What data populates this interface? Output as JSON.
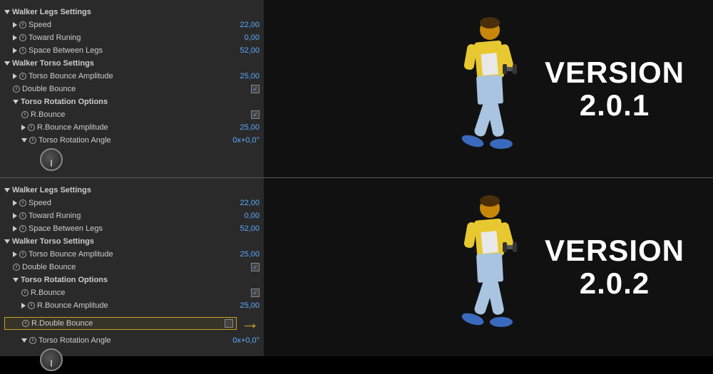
{
  "panel1": {
    "version": "VERSION\n2.0.1",
    "sections": {
      "legs_header": "Walker Legs Settings",
      "speed_label": "Speed",
      "speed_value": "22,00",
      "toward_label": "Toward Runing",
      "toward_value": "0,00",
      "space_label": "Space Between Legs",
      "space_value": "52,00",
      "torso_header": "Walker Torso Settings",
      "torso_bounce_label": "Torso Bounce Amplitude",
      "torso_bounce_value": "25,00",
      "double_bounce_label": "Double Bounce",
      "rotation_header": "Torso Rotation Options",
      "rbounce_label": "R.Bounce",
      "rbounce_amp_label": "R.Bounce Amplitude",
      "rbounce_amp_value": "25,00",
      "torso_rotation_label": "Torso Rotation Angle",
      "torso_rotation_value": "0x+0,0°"
    }
  },
  "panel2": {
    "version": "VERSION\n2.0.2",
    "sections": {
      "legs_header": "Walker Legs Settings",
      "speed_label": "Speed",
      "speed_value": "22,00",
      "toward_label": "Toward Runing",
      "toward_value": "0,00",
      "space_label": "Space Between Legs",
      "space_value": "52,00",
      "torso_header": "Walker Torso Settings",
      "torso_bounce_label": "Torso Bounce Amplitude",
      "torso_bounce_value": "25,00",
      "double_bounce_label": "Double Bounce",
      "rotation_header": "Torso Rotation Options",
      "rbounce_label": "R.Bounce",
      "rbounce_amp_label": "R.Bounce Amplitude",
      "rbounce_amp_value": "25,00",
      "rdouble_bounce_label": "R.Double Bounce",
      "torso_rotation_label": "Torso Rotation Angle",
      "torso_rotation_value": "0x+0,0°",
      "arrow_hint": "←"
    }
  }
}
